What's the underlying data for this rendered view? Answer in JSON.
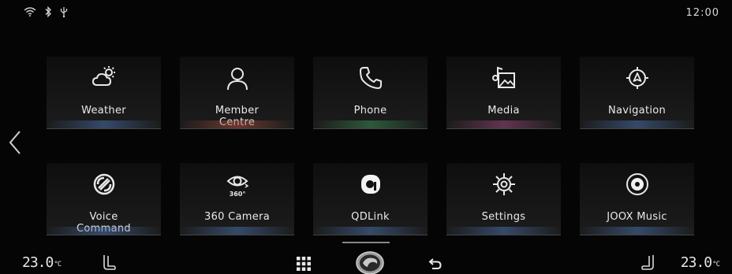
{
  "status": {
    "icons": [
      "wifi-icon",
      "bluetooth-icon",
      "usb-icon"
    ],
    "time": "12:00"
  },
  "tiles": [
    {
      "label": "Weather",
      "icon": "weather-icon",
      "glow": "#4a6fa8"
    },
    {
      "label": "Member\nCentre",
      "icon": "member-icon",
      "glow": "#a85040"
    },
    {
      "label": "Phone",
      "icon": "phone-icon",
      "glow": "#3e8a56"
    },
    {
      "label": "Media",
      "icon": "media-icon",
      "glow": "#9a4a7a"
    },
    {
      "label": "Navigation",
      "icon": "navigation-icon",
      "glow": "#4a6fa8"
    },
    {
      "label": "Voice\nCommand",
      "icon": "voice-command-icon",
      "glow": "#4a6fa8"
    },
    {
      "label": "360 Camera",
      "icon": "camera-360-icon",
      "glow": "#4a6fa8"
    },
    {
      "label": "QDLink",
      "icon": "qdlink-icon",
      "glow": "#4a6fa8"
    },
    {
      "label": "Settings",
      "icon": "settings-icon",
      "glow": "#4a6fa8"
    },
    {
      "label": "JOOX Music",
      "icon": "joox-music-icon",
      "glow": "#4a6fa8"
    }
  ],
  "camera_badge": "360°",
  "climate": {
    "left_temp": "23.0",
    "right_temp": "23.0",
    "unit": "°C"
  }
}
